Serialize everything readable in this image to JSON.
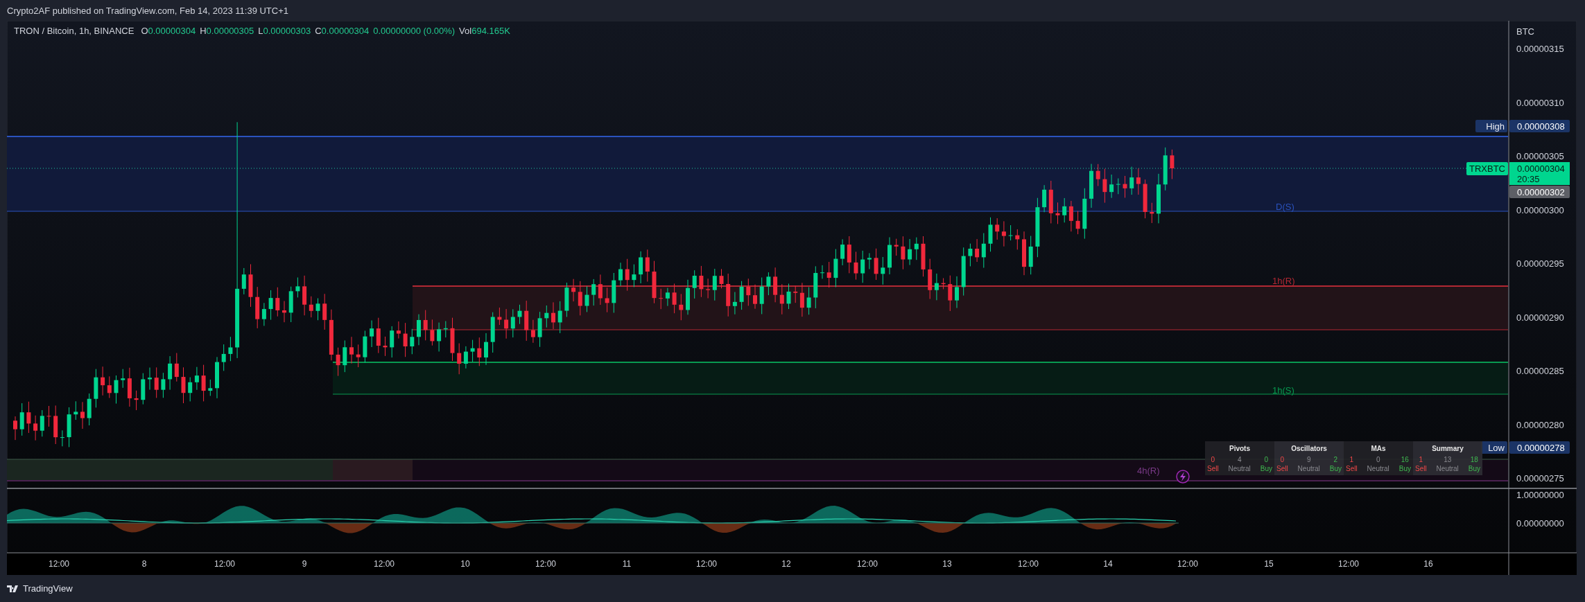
{
  "header": {
    "text": "Crypto2AF published on TradingView.com, Feb 14, 2023 11:39 UTC+1"
  },
  "legend": {
    "symbol": "TRON / Bitcoin, 1h, BINANCE",
    "fields": [
      {
        "label": "O",
        "value": "0.00000304"
      },
      {
        "label": "H",
        "value": "0.00000305"
      },
      {
        "label": "L",
        "value": "0.00000303"
      },
      {
        "label": "C",
        "value": "0.00000304"
      }
    ],
    "change": "0.00000000 (0.00%)",
    "volume": {
      "label": "Vol",
      "value": "694.165K"
    }
  },
  "price_axis": {
    "unit": "BTC",
    "ticks": [
      "0.00000315",
      "0.00000310",
      "0.00000305",
      "0.00000300",
      "0.00000295",
      "0.00000290",
      "0.00000285",
      "0.00000280",
      "0.00000275"
    ]
  },
  "price_badges": [
    {
      "kind": "high",
      "label": "High",
      "value": "0.00000308"
    },
    {
      "kind": "last",
      "label": "TRXBTC",
      "value": "0.00000304",
      "countdown": "20:35"
    },
    {
      "kind": "plain",
      "value": "0.00000302"
    },
    {
      "kind": "low",
      "label": "Low",
      "value": "0.00000278"
    }
  ],
  "zones": [
    {
      "kind": "daily",
      "label": "D(S)",
      "color": "#2a52be"
    },
    {
      "kind": "resistance",
      "label": "1h(R)",
      "color": "#b22833"
    },
    {
      "kind": "support",
      "label": "1h(S)",
      "color": "#089950"
    },
    {
      "kind": "strip",
      "label": "4h(R)",
      "color": "#7a3a88"
    }
  ],
  "indicator_axis": {
    "ticks": [
      "1.00000000",
      "0.00000000"
    ]
  },
  "time_axis": {
    "labels": [
      "12:00",
      "8",
      "12:00",
      "9",
      "12:00",
      "10",
      "12:00",
      "11",
      "12:00",
      "12",
      "12:00",
      "13",
      "12:00",
      "14",
      "12:00",
      "15",
      "12:00",
      "16"
    ]
  },
  "ratings_table": {
    "groups": [
      {
        "title": "Pivots",
        "sell": "0",
        "neutral": "4",
        "buy": "0",
        "sell_label": "Sell",
        "neutral_label": "Neutral",
        "buy_label": "Buy"
      },
      {
        "title": "Oscillators",
        "sell": "0",
        "neutral": "9",
        "buy": "2",
        "sell_label": "Sell",
        "neutral_label": "Neutral",
        "buy_label": "Buy"
      },
      {
        "title": "MAs",
        "sell": "1",
        "neutral": "0",
        "buy": "16",
        "sell_label": "Sell",
        "neutral_label": "Neutral",
        "buy_label": "Buy"
      },
      {
        "title": "Summary",
        "sell": "1",
        "neutral": "13",
        "buy": "18",
        "sell_label": "Sell",
        "neutral_label": "Neutral",
        "buy_label": "Buy"
      }
    ]
  },
  "footer": {
    "brand": "TradingView"
  }
}
